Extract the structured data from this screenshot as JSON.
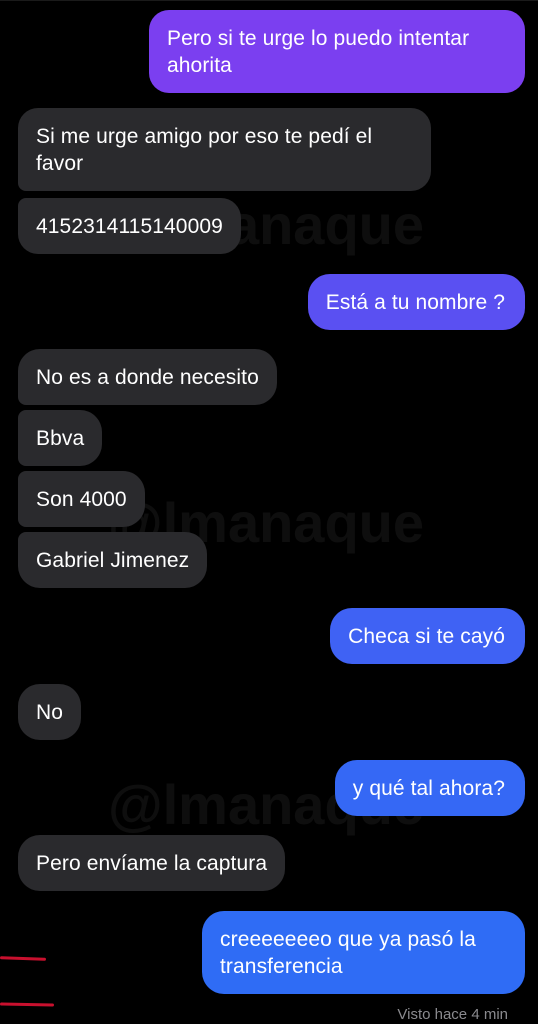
{
  "messages": [
    {
      "side": "out",
      "text": "Pero si te urge lo puedo intentar ahorita"
    },
    {
      "side": "in",
      "text": "Si me urge amigo por eso te pedí el favor"
    },
    {
      "side": "in",
      "text": "4152314115140009"
    },
    {
      "side": "out",
      "text": "Está a tu nombre ?"
    },
    {
      "side": "in",
      "text": "No es a donde necesito"
    },
    {
      "side": "in",
      "text": "Bbva"
    },
    {
      "side": "in",
      "text": "Son 4000"
    },
    {
      "side": "in",
      "text": "Gabriel Jimenez"
    },
    {
      "side": "out",
      "text": "Checa si te cayó"
    },
    {
      "side": "in",
      "text": "No"
    },
    {
      "side": "out",
      "text": "y qué tal ahora?"
    },
    {
      "side": "in",
      "text": "Pero envíame la captura"
    },
    {
      "side": "out",
      "text": "creeeeeeeo que ya pasó la transferencia"
    }
  ],
  "watermark": "@lmanaque",
  "seen_status": "Visto hace 4 min",
  "colors": {
    "background": "#000000",
    "incoming": "#2a2a2d",
    "outgoing_top": "#7a3ff0",
    "outgoing_bottom": "#2f6cf5",
    "annotation": "#c8102e"
  }
}
